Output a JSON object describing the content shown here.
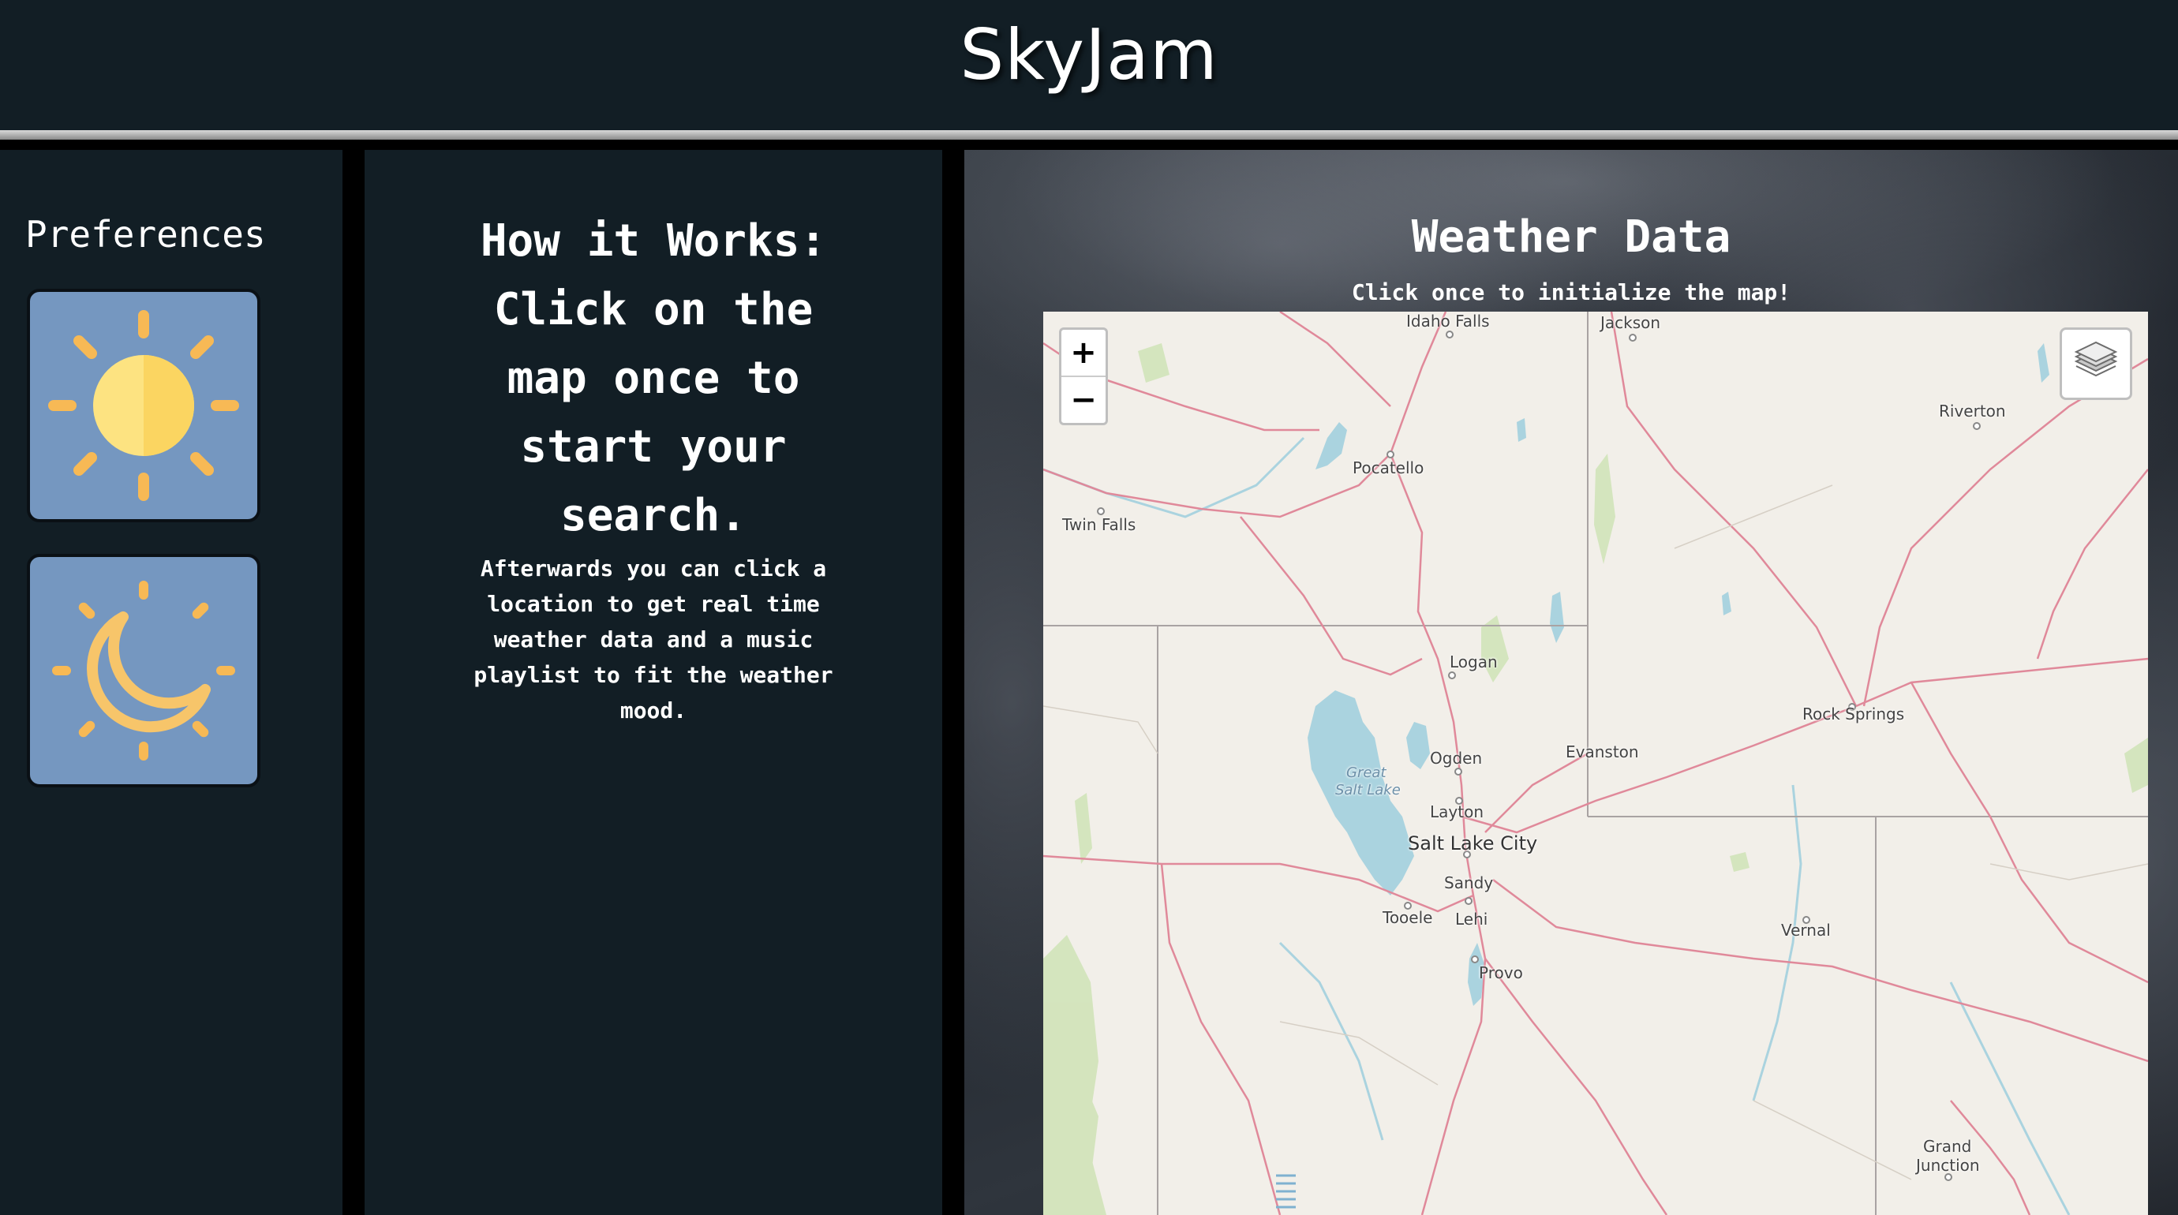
{
  "app": {
    "title": "SkyJam"
  },
  "preferences": {
    "title": "Preferences",
    "cards": [
      {
        "icon": "sun-icon"
      },
      {
        "icon": "moon-icon"
      }
    ]
  },
  "how_it_works": {
    "title_lines": [
      "How it Works:",
      "Click on the",
      "map once to",
      "start your",
      "search."
    ],
    "description_lines": [
      "Afterwards you can click a",
      "location to get real time",
      "weather data and a music",
      "playlist to fit the weather",
      "mood."
    ]
  },
  "weather": {
    "title": "Weather Data",
    "subtitle": "Click once to initialize the map!"
  },
  "map": {
    "zoom_in": "+",
    "zoom_out": "−",
    "layers_icon": "layers-icon",
    "colors": {
      "land": "#f2efe9",
      "roads": "#e0899a",
      "water": "#aad3df",
      "borders": "#a0a0a0",
      "forest": "#cfe3b6"
    },
    "labels": {
      "idaho_falls": "Idaho Falls",
      "jackson": "Jackson",
      "riverton": "Riverton",
      "pocatello": "Pocatello",
      "twin_falls": "Twin Falls",
      "logan": "Logan",
      "rock_springs": "Rock Springs",
      "evanston": "Evanston",
      "ogden": "Ogden",
      "great": "Great",
      "salt_lake": "Salt Lake",
      "layton": "Layton",
      "salt_lake_city": "Salt Lake City",
      "sandy": "Sandy",
      "tooele": "Tooele",
      "lehi": "Lehi",
      "vernal": "Vernal",
      "provo": "Provo",
      "grand": "Grand",
      "junction": "Junction"
    }
  }
}
